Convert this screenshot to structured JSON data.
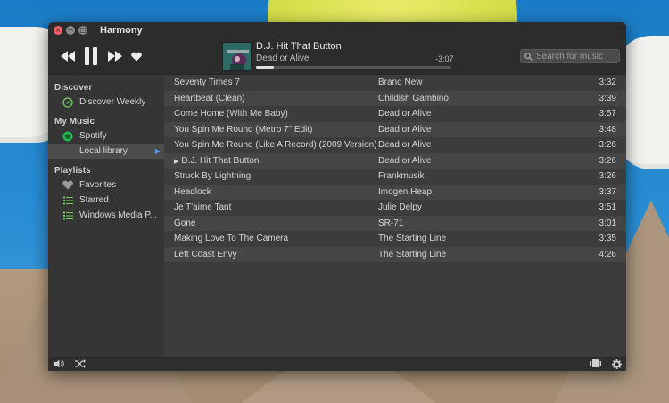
{
  "window": {
    "title": "Harmony"
  },
  "now_playing": {
    "title": "D.J. Hit That Button",
    "artist": "Dead or Alive",
    "remaining": "-3:07",
    "progress": 0.09
  },
  "search": {
    "placeholder": "Search for music"
  },
  "sidebar": {
    "sections": [
      {
        "heading": "Discover",
        "items": [
          {
            "label": "Discover Weekly",
            "icon": "compass-icon"
          }
        ]
      },
      {
        "heading": "My Music",
        "items": [
          {
            "label": "Spotify",
            "icon": "spotify-icon"
          },
          {
            "label": "Local library",
            "icon": "none",
            "active": true
          }
        ]
      },
      {
        "heading": "Playlists",
        "items": [
          {
            "label": "Favorites",
            "icon": "heart-icon"
          },
          {
            "label": "Starred",
            "icon": "list-icon"
          },
          {
            "label": "Windows Media P...",
            "icon": "list-icon"
          }
        ]
      }
    ]
  },
  "tracks": [
    {
      "title": "Seventy Times 7",
      "artist": "Brand New",
      "duration": "3:32"
    },
    {
      "title": "Heartbeat (Clean)",
      "artist": "Childish Gambino",
      "duration": "3:39"
    },
    {
      "title": "Come Home (With Me Baby)",
      "artist": "Dead or Alive",
      "duration": "3:57"
    },
    {
      "title": "You Spin Me Round (Metro 7\" Edit)",
      "artist": "Dead or Alive",
      "duration": "3:48"
    },
    {
      "title": "You Spin Me Round (Like A Record) (2009 Version)",
      "artist": "Dead or Alive",
      "duration": "3:26"
    },
    {
      "title": "D.J. Hit That Button",
      "artist": "Dead or Alive",
      "duration": "3:26",
      "playing": true
    },
    {
      "title": "Struck By Lightning",
      "artist": "Frankmusik",
      "duration": "3:26"
    },
    {
      "title": "Headlock",
      "artist": "Imogen Heap",
      "duration": "3:37"
    },
    {
      "title": "Je T'aime Tant",
      "artist": "Julie Delpy",
      "duration": "3:51"
    },
    {
      "title": "Gone",
      "artist": "SR-71",
      "duration": "3:01"
    },
    {
      "title": "Making Love To The Camera",
      "artist": "The Starting Line",
      "duration": "3:35"
    },
    {
      "title": "Left Coast Envy",
      "artist": "The Starting Line",
      "duration": "4:26"
    }
  ],
  "colors": {
    "accent": "#4fa0ea",
    "spotify": "#1db954",
    "close": "#f46067"
  }
}
